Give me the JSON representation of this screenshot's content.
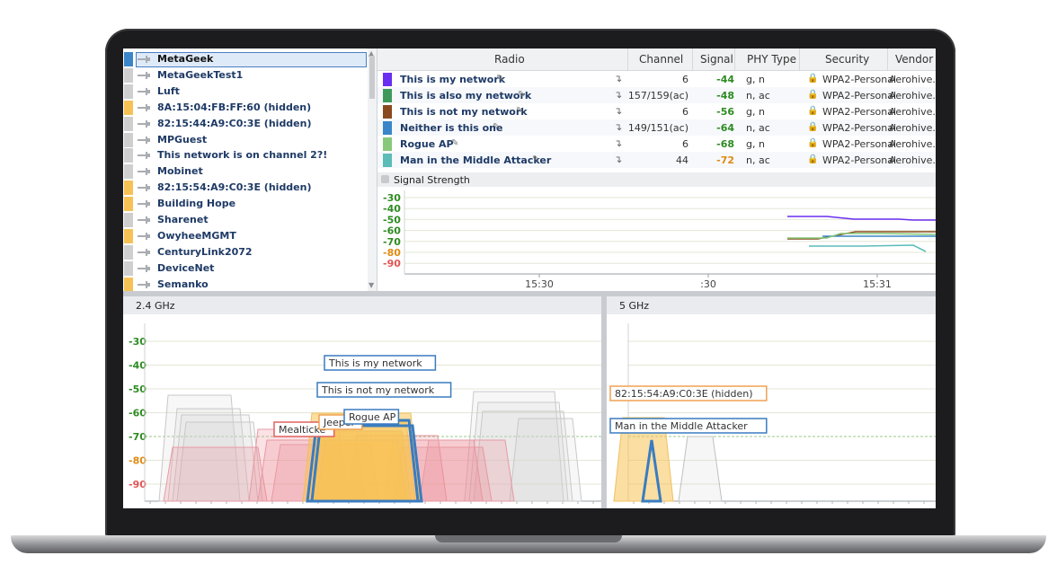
{
  "networks": [
    {
      "name": "MetaGeek",
      "color": "#3a86c8",
      "selected": true
    },
    {
      "name": "MetaGeekTest1",
      "color": "#cfcfcf"
    },
    {
      "name": "Luft",
      "color": "#cfcfcf"
    },
    {
      "name": "8A:15:04:FB:FF:60 (hidden)",
      "color": "#f7c255"
    },
    {
      "name": "82:15:44:A9:C0:3E (hidden)",
      "color": "#cfcfcf"
    },
    {
      "name": "MPGuest",
      "color": "#cfcfcf"
    },
    {
      "name": "This network is on channel 2?!",
      "color": "#cfcfcf"
    },
    {
      "name": "Mobinet",
      "color": "#cfcfcf"
    },
    {
      "name": "82:15:54:A9:C0:3E (hidden)",
      "color": "#f7c255"
    },
    {
      "name": "Building Hope",
      "color": "#f7c255"
    },
    {
      "name": "Sharenet",
      "color": "#cfcfcf"
    },
    {
      "name": "OwyheeMGMT",
      "color": "#f7c255"
    },
    {
      "name": "CenturyLink2072",
      "color": "#cfcfcf"
    },
    {
      "name": "DeviceNet",
      "color": "#cfcfcf"
    },
    {
      "name": "Semanko",
      "color": "#f7c255"
    }
  ],
  "table": {
    "columns": [
      "Radio",
      "Channel",
      "Signal",
      "PHY Type",
      "Security",
      "Vendor"
    ],
    "rows": [
      {
        "radio": "This is my network",
        "color": "#6a2ef0",
        "channel": "6",
        "signal": "-44",
        "signal_color": "#2e8b22",
        "phy": "g, n",
        "security": "WPA2-Personal",
        "vendor": "Aerohive..."
      },
      {
        "radio": "This is also my network",
        "color": "#3f9a5a",
        "channel": "157/159(ac)",
        "signal": "-48",
        "signal_color": "#2e8b22",
        "phy": "n, ac",
        "security": "WPA2-Personal",
        "vendor": "Aerohive..."
      },
      {
        "radio": "This is not my network",
        "color": "#8a4a1e",
        "channel": "6",
        "signal": "-56",
        "signal_color": "#2e8b22",
        "phy": "g, n",
        "security": "WPA2-Personal",
        "vendor": "Aerohive..."
      },
      {
        "radio": "Neither is this one",
        "color": "#3a86c8",
        "channel": "149/151(ac)",
        "signal": "-64",
        "signal_color": "#2e8b22",
        "phy": "n, ac",
        "security": "WPA2-Personal",
        "vendor": "Aerohive..."
      },
      {
        "radio": "Rogue AP",
        "color": "#86c97a",
        "channel": "6",
        "signal": "-68",
        "signal_color": "#2e8b22",
        "phy": "g, n",
        "security": "WPA2-Personal",
        "vendor": "Aerohive..."
      },
      {
        "radio": "Man in the Middle Attacker",
        "color": "#5bbcb8",
        "channel": "44",
        "signal": "-72",
        "signal_color": "#e08a12",
        "phy": "n, ac",
        "security": "WPA2-Personal",
        "vendor": "Aerohive..."
      }
    ]
  },
  "signal_strength": {
    "title": "Signal Strength",
    "y_ticks": [
      "-30",
      "-40",
      "-50",
      "-60",
      "-70",
      "-80",
      "-90"
    ],
    "x_ticks": [
      "15:30",
      ":30",
      "15:31"
    ]
  },
  "spectrum": {
    "band24_title": "2.4 GHz",
    "band5_title": "5 GHz",
    "y_ticks": [
      "-30",
      "-40",
      "-50",
      "-60",
      "-70",
      "-80",
      "-90"
    ],
    "labels24": [
      "This is my network",
      "This is not my network",
      "Rogue AP",
      "Mealticke",
      "Jeeper"
    ],
    "labels5": [
      "82:15:54:A9:C0:3E (hidden)",
      "Man in the Middle Attacker"
    ]
  }
}
